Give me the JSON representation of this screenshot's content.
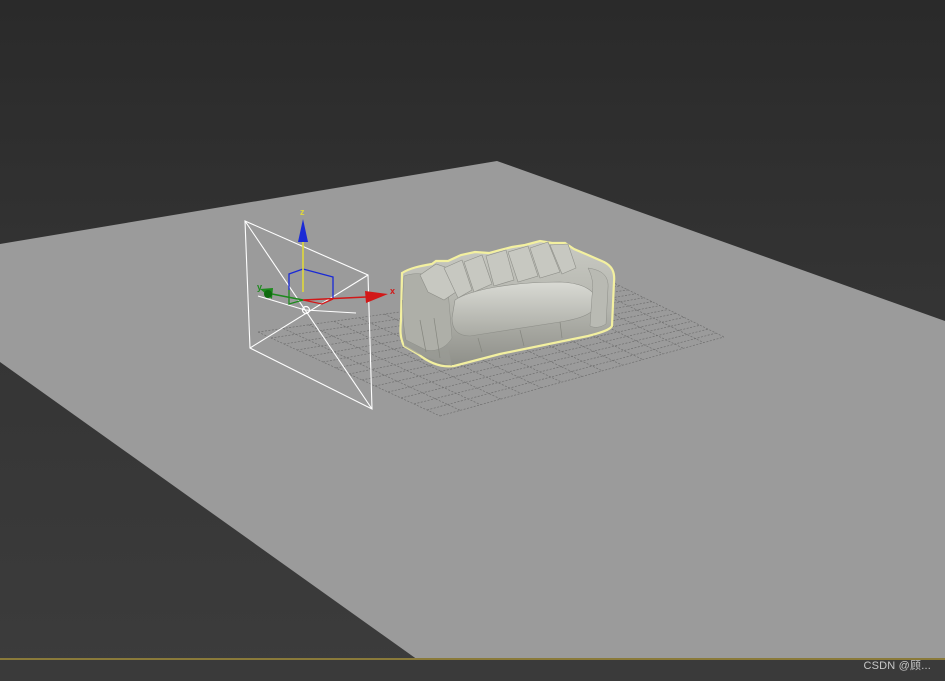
{
  "viewport": {
    "background_top": "#2a2a2a",
    "background_bottom": "#3c3c3c",
    "ground_color": "#9c9c9c",
    "grid_color": "#6e6e6e",
    "selection_color": "#f3f0a0",
    "border_color": "#8a7a3a"
  },
  "gizmo": {
    "x_label": "x",
    "y_label": "y",
    "z_label": "z",
    "x_color": "#d21818",
    "y_color": "#1d8a1d",
    "z_color": "#1a2ad6",
    "z_line_color": "#e0d83a"
  },
  "objects": {
    "camera": "camera-wireframe",
    "sofa": "sofa-mesh (selected)"
  },
  "footer": {
    "watermark": "CSDN @顾..."
  }
}
